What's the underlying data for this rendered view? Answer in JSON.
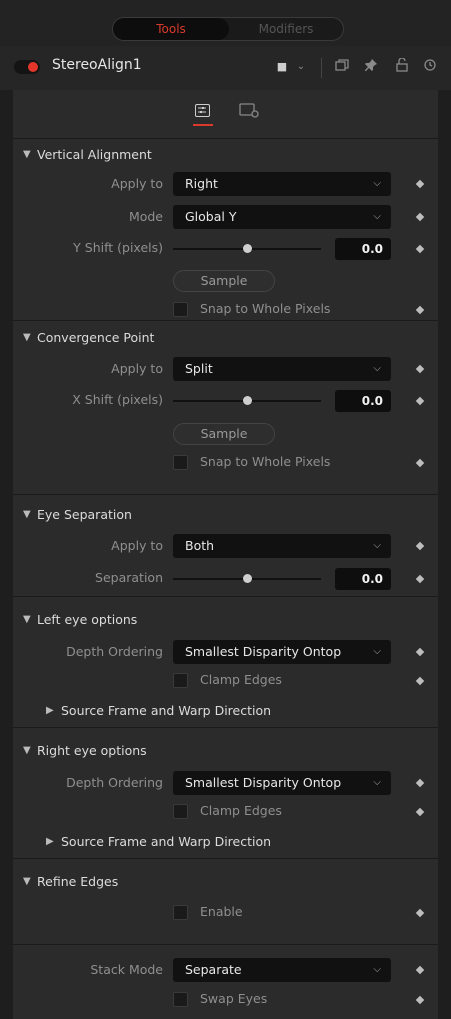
{
  "top_tabs": {
    "tools": "Tools",
    "modifiers": "Modifiers"
  },
  "header": {
    "tool_name": "StereoAlign1"
  },
  "icons": {
    "color_swatch": "■",
    "chevron": "⌄",
    "copy": "❐",
    "pin": "📌",
    "lock": "🔓",
    "reset": "↺"
  },
  "sections": {
    "vertical": {
      "title": "Vertical Alignment",
      "apply_label": "Apply to",
      "apply_value": "Right",
      "mode_label": "Mode",
      "mode_value": "Global Y",
      "shift_label": "Y Shift (pixels)",
      "shift_value": "0.0",
      "sample_label": "Sample",
      "snap_label": "Snap to Whole Pixels"
    },
    "convergence": {
      "title": "Convergence Point",
      "apply_label": "Apply to",
      "apply_value": "Split",
      "shift_label": "X Shift (pixels)",
      "shift_value": "0.0",
      "sample_label": "Sample",
      "snap_label": "Snap to Whole Pixels"
    },
    "eye_sep": {
      "title": "Eye Separation",
      "apply_label": "Apply to",
      "apply_value": "Both",
      "sep_label": "Separation",
      "sep_value": "0.0"
    },
    "left": {
      "title": "Left eye options",
      "depth_label": "Depth Ordering",
      "depth_value": "Smallest Disparity Ontop",
      "clamp_label": "Clamp Edges",
      "sub_title": "Source Frame and Warp Direction"
    },
    "right": {
      "title": "Right eye options",
      "depth_label": "Depth Ordering",
      "depth_value": "Smallest Disparity Ontop",
      "clamp_label": "Clamp Edges",
      "sub_title": "Source Frame and Warp Direction"
    },
    "refine": {
      "title": "Refine Edges",
      "enable_label": "Enable"
    },
    "stack": {
      "stack_label": "Stack Mode",
      "stack_value": "Separate",
      "swap_label": "Swap Eyes"
    }
  },
  "colors": {
    "accent": "#d93a2b",
    "panel_bg": "#2b2b2b",
    "field_bg": "#111111"
  }
}
